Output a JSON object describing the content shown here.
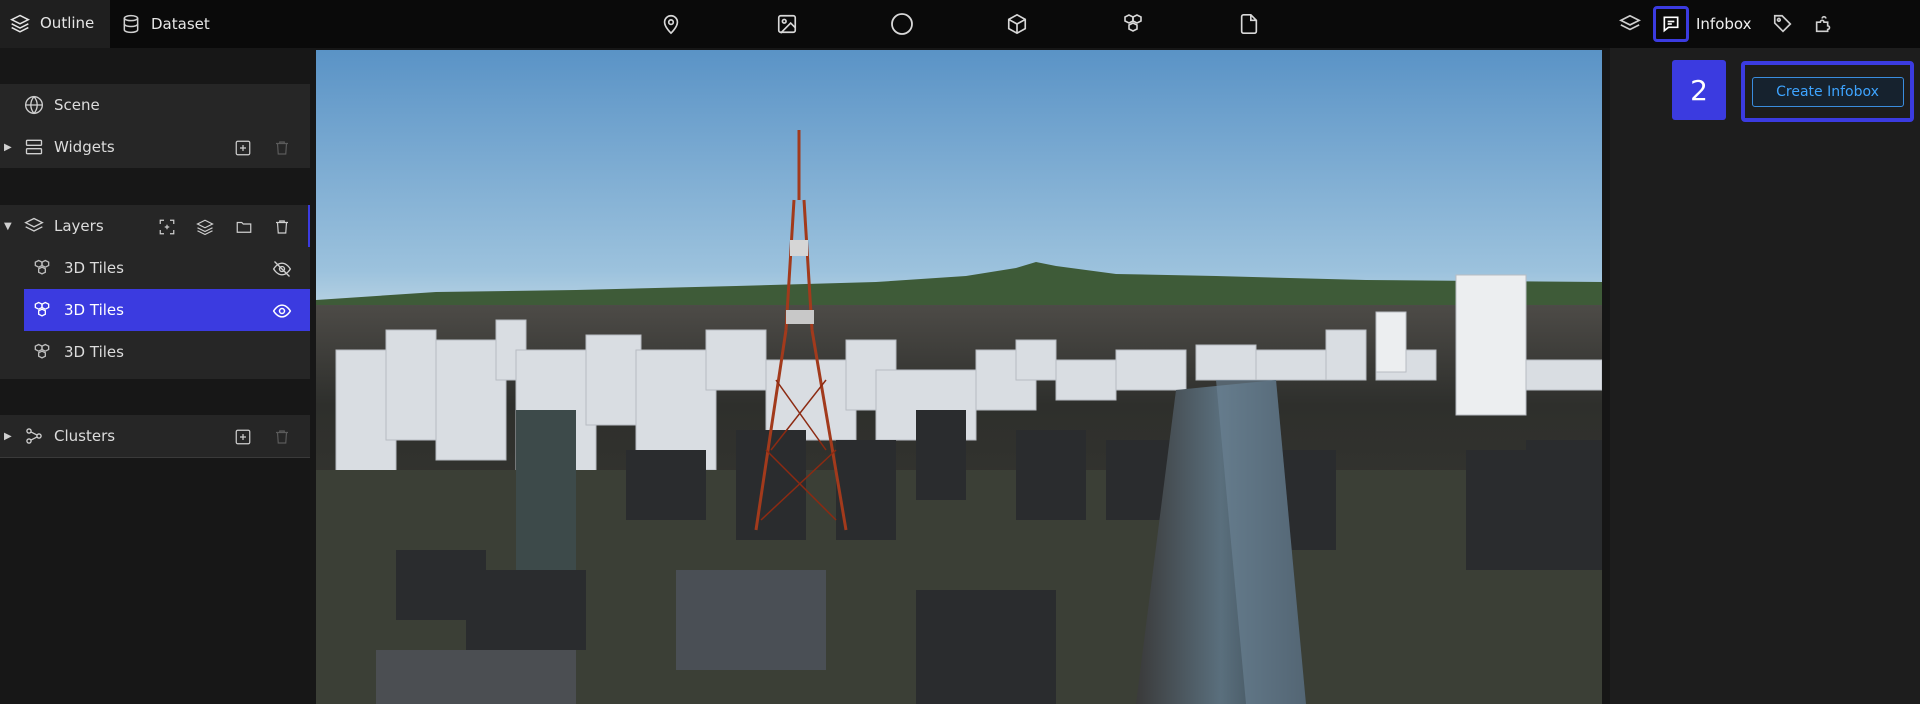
{
  "header": {
    "tabs": [
      {
        "label": "Outline",
        "icon": "layers-icon"
      },
      {
        "label": "Dataset",
        "icon": "database-icon"
      }
    ],
    "tools": [
      "map-pin-icon",
      "image-icon",
      "circle-icon",
      "polygon-icon",
      "3d-tiles-icon",
      "file-icon"
    ],
    "right_tools": {
      "layer_style": "layers-icon",
      "infobox_label": "Infobox",
      "infobox_icon": "chat-box-icon",
      "tag": "tag-icon",
      "plugin": "puzzle-icon"
    }
  },
  "outline": {
    "scene": {
      "label": "Scene",
      "icon": "globe-icon"
    },
    "widgets": {
      "label": "Widgets",
      "icon": "widgets-icon"
    },
    "layers": {
      "label": "Layers",
      "items": [
        {
          "label": "3D Tiles",
          "icon": "3d-tiles-icon",
          "visibility": "hidden",
          "selected": false
        },
        {
          "label": "3D Tiles",
          "icon": "3d-tiles-icon",
          "visibility": "visible",
          "selected": true
        },
        {
          "label": "3D Tiles",
          "icon": "3d-tiles-icon",
          "visibility": "none",
          "selected": false
        }
      ]
    },
    "clusters": {
      "label": "Clusters",
      "icon": "cluster-icon"
    }
  },
  "infobox_panel": {
    "step_badge": "2",
    "create_button_label": "Create Infobox"
  },
  "colors": {
    "accent": "#3b3be0",
    "link_blue": "#3ea4ff",
    "panel_bg": "#171717",
    "topbar_bg": "#0a0a0a"
  }
}
